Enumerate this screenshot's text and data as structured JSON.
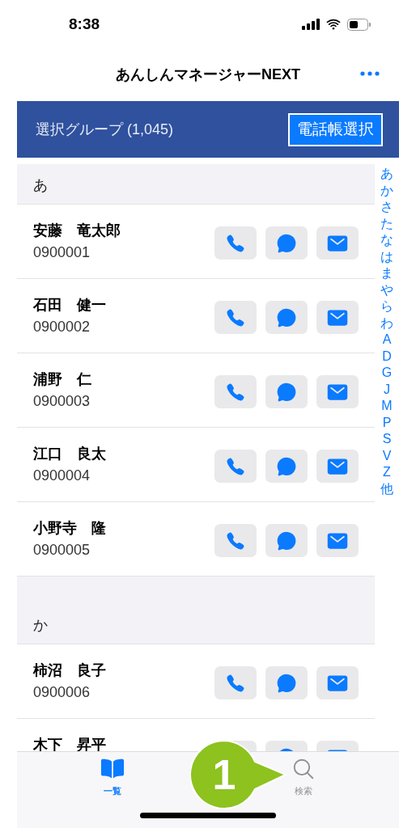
{
  "status_bar": {
    "time": "8:38"
  },
  "nav": {
    "title": "あんしんマネージャーNEXT"
  },
  "group_bar": {
    "label": "選択グループ (1,045)",
    "button": "電話帳選択"
  },
  "sections": [
    {
      "header": "あ",
      "contacts": [
        {
          "name": "安藤　竜太郎",
          "number": "0900001"
        },
        {
          "name": "石田　健一",
          "number": "0900002"
        },
        {
          "name": "浦野　仁",
          "number": "0900003"
        },
        {
          "name": "江口　良太",
          "number": "0900004"
        },
        {
          "name": "小野寺　隆",
          "number": "0900005"
        }
      ]
    },
    {
      "header": "か",
      "contacts": [
        {
          "name": "柿沼　良子",
          "number": "0900006"
        },
        {
          "name": "木下　昇平"
        }
      ]
    }
  ],
  "index": [
    "あ",
    "か",
    "さ",
    "た",
    "な",
    "は",
    "ま",
    "や",
    "ら",
    "わ",
    "A",
    "D",
    "G",
    "J",
    "M",
    "P",
    "S",
    "V",
    "Z",
    "他"
  ],
  "tabs": [
    {
      "label": "一覧",
      "selected": true,
      "kind": "book"
    },
    {
      "label": "検索",
      "selected": false,
      "kind": "search"
    }
  ],
  "callout": {
    "label": "1"
  }
}
